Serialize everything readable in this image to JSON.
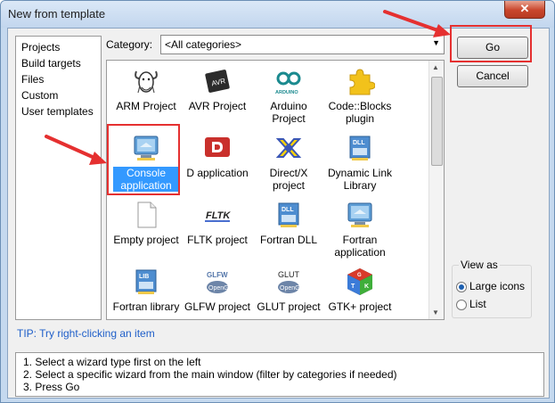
{
  "window": {
    "title": "New from template",
    "close_glyph": "✕"
  },
  "sidebar": {
    "items": [
      {
        "label": "Projects"
      },
      {
        "label": "Build targets"
      },
      {
        "label": "Files"
      },
      {
        "label": "Custom"
      },
      {
        "label": "User templates"
      }
    ]
  },
  "category": {
    "label": "Category:",
    "selected": "<All categories>",
    "dropdown_icon": "chevron-down-icon"
  },
  "templates": [
    {
      "label": "ARM Project",
      "icon": "gnu-icon",
      "selected": false
    },
    {
      "label": "AVR Project",
      "icon": "avr-chip-icon",
      "selected": false
    },
    {
      "label": "Arduino Project",
      "icon": "arduino-icon",
      "selected": false
    },
    {
      "label": "Code::Blocks plugin",
      "icon": "puzzle-piece-icon",
      "selected": false
    },
    {
      "label": "Console application",
      "icon": "console-monitor-icon",
      "selected": true
    },
    {
      "label": "D application",
      "icon": "d-language-icon",
      "selected": false
    },
    {
      "label": "Direct/X project",
      "icon": "directx-icon",
      "selected": false
    },
    {
      "label": "Dynamic Link Library",
      "icon": "dll-icon",
      "selected": false
    },
    {
      "label": "Empty project",
      "icon": "blank-page-icon",
      "selected": false
    },
    {
      "label": "FLTK project",
      "icon": "fltk-icon",
      "selected": false
    },
    {
      "label": "Fortran DLL",
      "icon": "dll-icon",
      "selected": false
    },
    {
      "label": "Fortran application",
      "icon": "console-monitor-icon",
      "selected": false
    },
    {
      "label": "Fortran library",
      "icon": "library-icon",
      "selected": false
    },
    {
      "label": "GLFW project",
      "icon": "glfw-opengl-icon",
      "selected": false
    },
    {
      "label": "GLUT project",
      "icon": "glut-opengl-icon",
      "selected": false
    },
    {
      "label": "GTK+ project",
      "icon": "gtk-cube-icon",
      "selected": false
    }
  ],
  "icon_text": {
    "avr": "AVR",
    "arduino": "ARDUINO",
    "dll": "DLL",
    "fltk": "FLTK",
    "lib": "LIB",
    "glfw": "GLFW",
    "glut": "GLUT",
    "opengl": "OpenGL",
    "gtk_g": "G",
    "gtk_t": "T",
    "gtk_k": "K"
  },
  "buttons": {
    "go": "Go",
    "cancel": "Cancel"
  },
  "view_as": {
    "title": "View as",
    "options": [
      {
        "label": "Large icons",
        "checked": true
      },
      {
        "label": "List",
        "checked": false
      }
    ]
  },
  "tip": "TIP: Try right-clicking an item",
  "steps": [
    "1. Select a wizard type first on the left",
    "2. Select a specific wizard from the main window (filter by categories if needed)",
    "3. Press Go"
  ],
  "colors": {
    "selection": "#3399ff",
    "annotation": "#e53030",
    "tip_text": "#1f5fc9",
    "title_bar": "#c5d9ef"
  }
}
